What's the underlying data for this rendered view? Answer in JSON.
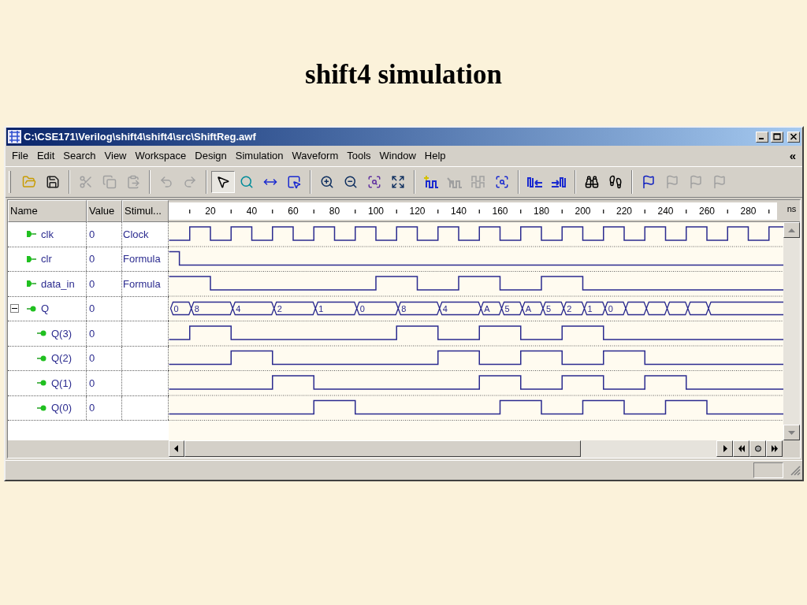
{
  "slide_title": "shift4 simulation",
  "window": {
    "title": "C:\\CSE171\\Verilog\\shift4\\shift4\\src\\ShiftReg.awf"
  },
  "menu": [
    "File",
    "Edit",
    "Search",
    "View",
    "Workspace",
    "Design",
    "Simulation",
    "Waveform",
    "Tools",
    "Window",
    "Help"
  ],
  "menu_overflow": "«",
  "toolbar": [
    {
      "kind": "open",
      "disabled": false,
      "pressed": false
    },
    {
      "kind": "save",
      "disabled": false,
      "pressed": false
    },
    {
      "kind": "cut",
      "disabled": true,
      "pressed": false
    },
    {
      "kind": "copy",
      "disabled": true,
      "pressed": false
    },
    {
      "kind": "paste",
      "disabled": true,
      "pressed": false
    },
    {
      "kind": "undo",
      "disabled": true,
      "pressed": false
    },
    {
      "kind": "redo",
      "disabled": true,
      "pressed": false
    },
    {
      "kind": "pointer",
      "disabled": false,
      "pressed": true
    },
    {
      "kind": "zoom",
      "disabled": false,
      "pressed": false
    },
    {
      "kind": "measure",
      "disabled": false,
      "pressed": false
    },
    {
      "kind": "select",
      "disabled": false,
      "pressed": false
    },
    {
      "kind": "zoom-in",
      "disabled": false,
      "pressed": false
    },
    {
      "kind": "zoom-out",
      "disabled": false,
      "pressed": false
    },
    {
      "kind": "zoom-area",
      "disabled": false,
      "pressed": false
    },
    {
      "kind": "zoom-fit",
      "disabled": false,
      "pressed": false
    },
    {
      "kind": "add-signal",
      "disabled": false,
      "pressed": false
    },
    {
      "kind": "delete-signal",
      "disabled": true,
      "pressed": false
    },
    {
      "kind": "group-signals",
      "disabled": true,
      "pressed": false
    },
    {
      "kind": "browse",
      "disabled": false,
      "pressed": false
    },
    {
      "kind": "shift-left",
      "disabled": false,
      "pressed": false
    },
    {
      "kind": "shift-right",
      "disabled": false,
      "pressed": false
    },
    {
      "kind": "find",
      "disabled": false,
      "pressed": false
    },
    {
      "kind": "trace",
      "disabled": false,
      "pressed": false
    },
    {
      "kind": "flag",
      "disabled": false,
      "pressed": false
    },
    {
      "kind": "flag",
      "disabled": true,
      "pressed": false
    },
    {
      "kind": "flag",
      "disabled": true,
      "pressed": false
    },
    {
      "kind": "flag",
      "disabled": true,
      "pressed": false
    }
  ],
  "columns": [
    "Name",
    "Value",
    "Stimul..."
  ],
  "ruler": {
    "ticks": [
      "20",
      "40",
      "60",
      "80",
      "100",
      "120",
      "140",
      "160",
      "180",
      "200",
      "220",
      "240",
      "260",
      "280"
    ],
    "unit": "ns"
  },
  "signals": [
    {
      "name": "clk",
      "kind": "input",
      "value": "0",
      "stimulus": "Clock"
    },
    {
      "name": "clr",
      "kind": "input",
      "value": "0",
      "stimulus": "Formula"
    },
    {
      "name": "data_in",
      "kind": "input",
      "value": "0",
      "stimulus": "Formula"
    },
    {
      "name": "Q",
      "kind": "bus",
      "value": "0",
      "expanded": true,
      "bus_values": [
        "0",
        "8",
        "4",
        "2",
        "1",
        "0",
        "8",
        "4",
        "A",
        "5",
        "A",
        "5",
        "2",
        "1",
        "0"
      ],
      "children": [
        {
          "name": "Q(3)",
          "kind": "output",
          "value": "0"
        },
        {
          "name": "Q(2)",
          "kind": "output",
          "value": "0"
        },
        {
          "name": "Q(1)",
          "kind": "output",
          "value": "0"
        },
        {
          "name": "Q(0)",
          "kind": "output",
          "value": "0"
        }
      ]
    }
  ]
}
